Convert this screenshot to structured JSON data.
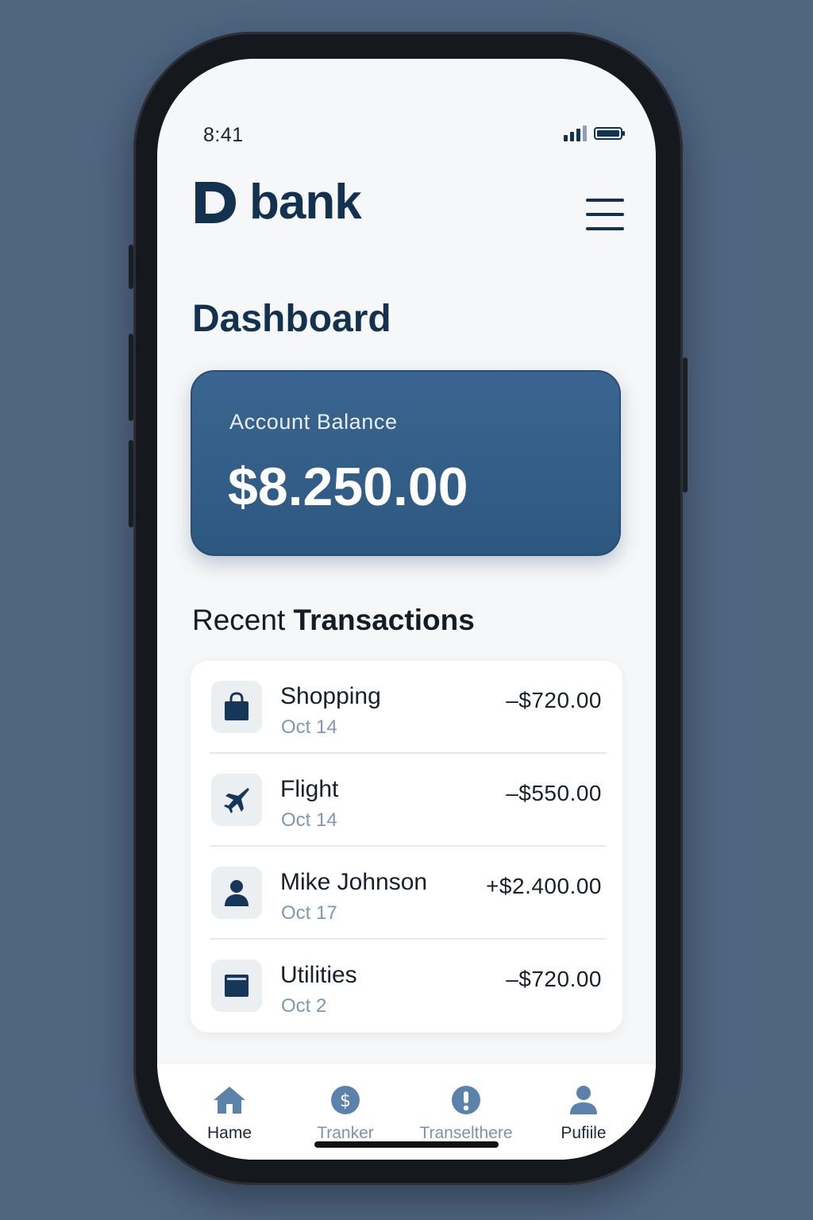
{
  "status_bar": {
    "time": "8:41"
  },
  "header": {
    "logo_letter": "D",
    "logo_text": "bank"
  },
  "page": {
    "title": "Dashboard"
  },
  "balance": {
    "label": "Account Balance",
    "value": "$8.250.00"
  },
  "transactions": {
    "title_light": "Recent ",
    "title_bold": "Transactions",
    "items": [
      {
        "name": "Shopping",
        "date": "Oct 14",
        "amount": "–$720.00",
        "icon": "shopping-bag-icon"
      },
      {
        "name": "Flight",
        "date": "Oct 14",
        "amount": "–$550.00",
        "icon": "airplane-icon"
      },
      {
        "name": "Mike Johnson",
        "date": "Oct 17",
        "amount": "+$2.400.00",
        "icon": "person-icon"
      },
      {
        "name": "Utilities",
        "date": "Oct 2",
        "amount": "–$720.00",
        "icon": "bill-icon"
      }
    ]
  },
  "nav": {
    "items": [
      {
        "label": "Hame",
        "icon": "home-icon"
      },
      {
        "label": "Tranker",
        "icon": "dollar-icon"
      },
      {
        "label": "Transelthere",
        "icon": "alert-icon"
      },
      {
        "label": "Pufiile",
        "icon": "profile-icon"
      }
    ]
  },
  "colors": {
    "primary": "#12324f",
    "card": "#2f5b84",
    "accent": "#5b82aa",
    "muted": "#7f97b2"
  }
}
